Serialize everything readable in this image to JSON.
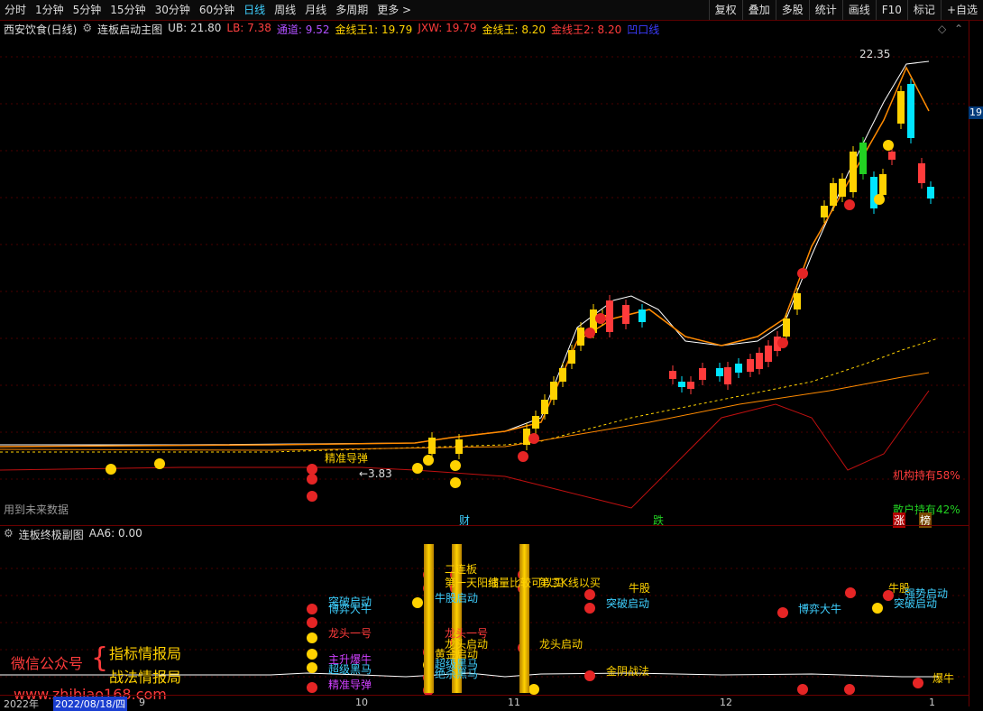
{
  "toolbar": {
    "periods": [
      "分时",
      "1分钟",
      "5分钟",
      "15分钟",
      "30分钟",
      "60分钟",
      "日线",
      "周线",
      "月线",
      "多周期",
      "更多 >"
    ],
    "active_period": "日线",
    "right_buttons": [
      "复权",
      "叠加",
      "多股",
      "统计",
      "画线",
      "F10",
      "标记",
      "+自选"
    ]
  },
  "main_info": {
    "title": "西安饮食(日线)",
    "indicator": "连板启动主图",
    "ub": "UB: 21.80",
    "lb": "LB: 7.38",
    "tongdao": "通道: 9.52",
    "jxw1": "金线王1: 19.79",
    "jxw": "JXW: 19.79",
    "jxw_b": "金线王: 8.20",
    "jxw2": "金线王2: 8.20",
    "aoxian": "凹口线"
  },
  "sub_info": {
    "indicator": "连板终极副图",
    "aa6": "AA6: 0.00"
  },
  "main_labels": {
    "high_price": "22.35",
    "low_price": "←3.83",
    "precise_signal": "精准导弹",
    "future_data": "用到未来数据",
    "institution": "机构持有58%",
    "retail": "散户持有42%",
    "cai": "财",
    "die": "跌",
    "zhang": "涨",
    "bang": "榜",
    "axis_badge": "19"
  },
  "sub_labels": {
    "tupo1": "突破启动",
    "boyi1": "博弈大牛",
    "longtou1": "龙头一号",
    "zhusheng": "主升爆牛",
    "chaoji1": "超级黑马",
    "jingzhun": "精准导弹",
    "erlianban": "二连板",
    "diyi": "第一天阳线",
    "sanyi": "缩量比较可以买",
    "dierk": "第二K线以买",
    "niugu1": "牛股启动",
    "longtou2": "龙头一号",
    "zhusheng2": "龙头启动",
    "qiantai": "黄金启动",
    "chaoji2": "超级黑马",
    "juesha": "绝杀黑马",
    "niugu2": "牛股",
    "tupo2": "突破启动",
    "longtou3": "龙头启动",
    "jinyin": "金阴战法",
    "boyi2": "博弈大牛",
    "niugu3": "牛股",
    "qiangshi": "强势启动",
    "tupo3": "突破启动",
    "baoniu": "爆牛"
  },
  "watermark": {
    "wechat": "微信公众号",
    "zhibiao": "指标情报局",
    "zhanfa": "战法情报局",
    "url": "www.zhibiao168.com"
  },
  "xaxis": {
    "year": "2022年",
    "date": "2022/08/18/四",
    "m9": "9",
    "m10": "10",
    "m11": "11",
    "m12": "12",
    "m1": "1"
  },
  "colors": {
    "up": "#ff3b3b",
    "down": "#00e5ff",
    "gold": "#ffd200",
    "orange": "#ff8a00",
    "white_line": "#ffffff",
    "axis": "#6a0000"
  },
  "chart_data": {
    "type": "candlestick",
    "title": "西安饮食(日线)",
    "ylim": [
      3.83,
      22.35
    ],
    "price_high": 22.35,
    "price_low": 3.83,
    "ub": 21.8,
    "lb": 7.38,
    "tongdao": 9.52,
    "jxw1": 19.79,
    "jxw": 19.79,
    "jxw_b": 8.2,
    "jxw2": 8.2,
    "aa6": 0.0,
    "holdings": {
      "institution_pct": 58,
      "retail_pct": 42
    }
  }
}
